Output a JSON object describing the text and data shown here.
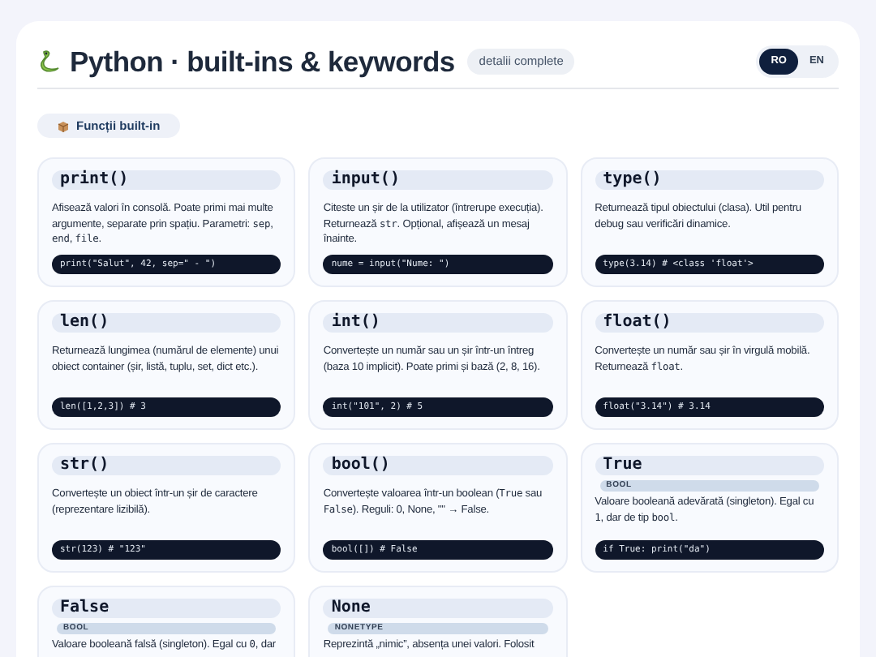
{
  "header": {
    "title": "Python · built-ins & keywords",
    "badge": "detalii complete"
  },
  "languages": [
    {
      "label": "RO",
      "selected": true
    },
    {
      "label": "EN",
      "selected": false
    }
  ],
  "section": {
    "label": "Funcții built-in"
  },
  "cards": [
    {
      "name": "print()",
      "description": [
        {
          "text": "Afisează valori în consolă. Poate primi mai multe argumente, separate prin spațiu. Parametri: ",
          "code": false
        },
        {
          "text": "sep",
          "code": true
        },
        {
          "text": ", ",
          "code": false
        },
        {
          "text": "end",
          "code": true
        },
        {
          "text": ", ",
          "code": false
        },
        {
          "text": "file",
          "code": true
        },
        {
          "text": ".",
          "code": false
        }
      ],
      "example": "print(\"Salut\", 42, sep=\" - \")"
    },
    {
      "name": "input()",
      "description": [
        {
          "text": "Citeste un șir de la utilizator (întrerupe execuția). Returnează ",
          "code": false
        },
        {
          "text": "str",
          "code": true
        },
        {
          "text": ". Opțional, afișează un mesaj înainte.",
          "code": false
        }
      ],
      "example": "nume = input(\"Nume: \")"
    },
    {
      "name": "type()",
      "description": [
        {
          "text": "Returnează tipul obiectului (clasa). Util pentru debug sau verificări dinamice.",
          "code": false
        }
      ],
      "example": "type(3.14) # <class 'float'>"
    },
    {
      "name": "len()",
      "description": [
        {
          "text": "Returnează lungimea (numărul de elemente) unui obiect container (șir, listă, tuplu, set, dict etc.).",
          "code": false
        }
      ],
      "example": "len([1,2,3]) # 3"
    },
    {
      "name": "int()",
      "description": [
        {
          "text": "Convertește un număr sau un șir într-un întreg (baza 10 implicit). Poate primi și bază (2, 8, 16).",
          "code": false
        }
      ],
      "example": "int(\"101\", 2) # 5"
    },
    {
      "name": "float()",
      "description": [
        {
          "text": "Convertește un număr sau șir în virgulă mobilă. Returnează ",
          "code": false
        },
        {
          "text": "float",
          "code": true
        },
        {
          "text": ".",
          "code": false
        }
      ],
      "example": "float(\"3.14\") # 3.14"
    },
    {
      "name": "str()",
      "description": [
        {
          "text": "Convertește un obiect într-un șir de caractere (reprezentare lizibilă).",
          "code": false
        }
      ],
      "example": "str(123) # \"123\""
    },
    {
      "name": "bool()",
      "description": [
        {
          "text": "Convertește valoarea într-un boolean (",
          "code": false
        },
        {
          "text": "True",
          "code": true
        },
        {
          "text": " sau ",
          "code": false
        },
        {
          "text": "False",
          "code": true
        },
        {
          "text": "). Reguli: 0, None, \"\" → False.",
          "code": false
        }
      ],
      "example": "bool([]) # False"
    },
    {
      "name": "True",
      "tag": "BOOL",
      "description": [
        {
          "text": "Valoare booleană adevărată (singleton). Egal cu ",
          "code": false
        },
        {
          "text": "1",
          "code": true
        },
        {
          "text": ", dar de tip ",
          "code": false
        },
        {
          "text": "bool",
          "code": true
        },
        {
          "text": ".",
          "code": false
        }
      ],
      "example": "if True: print(\"da\")"
    },
    {
      "name": "False",
      "tag": "BOOL",
      "description": [
        {
          "text": "Valoare booleană falsă (singleton). Egal cu ",
          "code": false
        },
        {
          "text": "0",
          "code": true
        },
        {
          "text": ", dar",
          "code": false
        }
      ]
    },
    {
      "name": "None",
      "tag": "NONETYPE",
      "description": [
        {
          "text": "Reprezintă „nimic”, absența unei valori. Folosit",
          "code": false
        }
      ]
    }
  ]
}
